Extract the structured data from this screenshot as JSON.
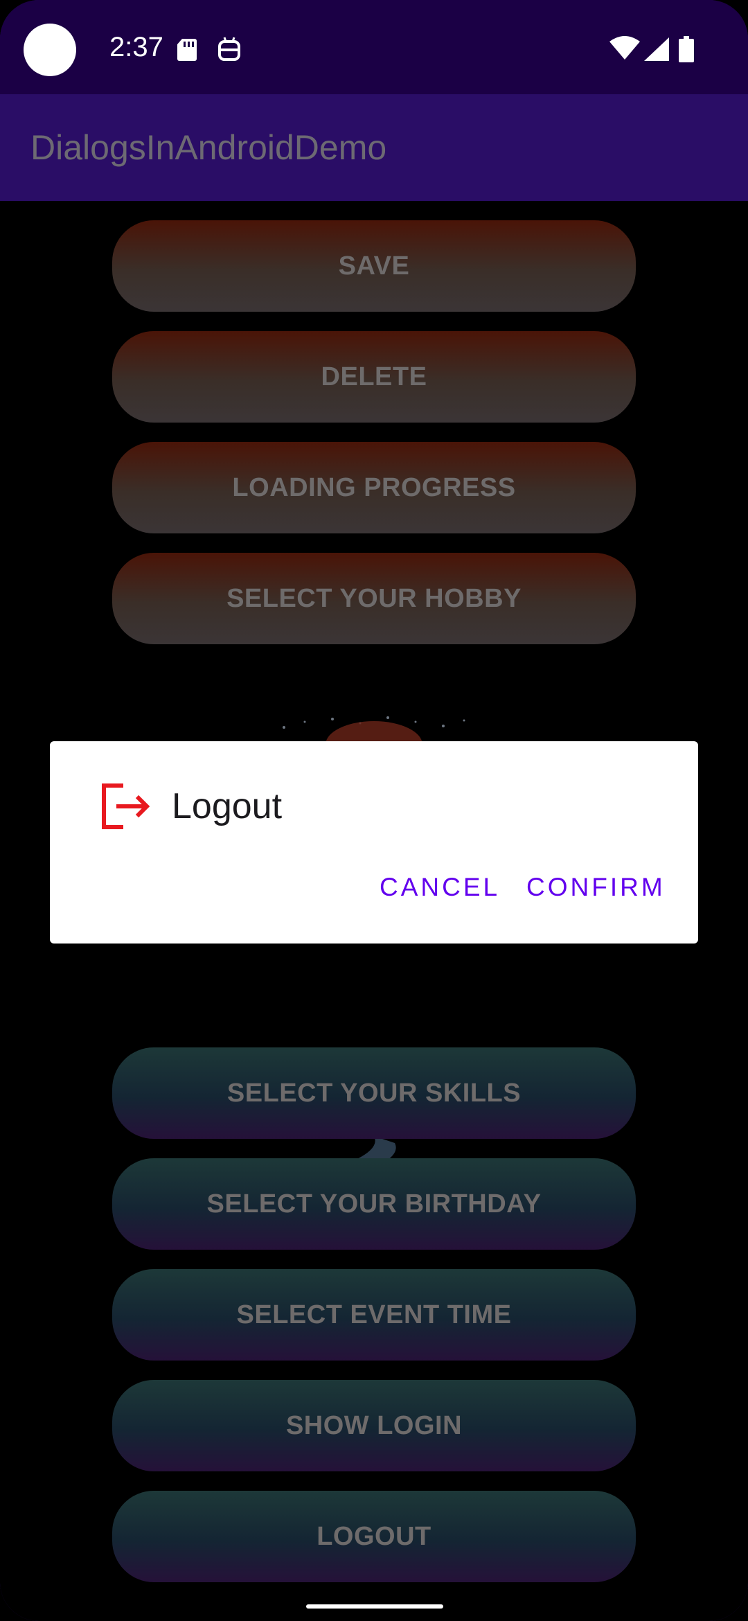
{
  "status_bar": {
    "time": "2:37",
    "icons": [
      "camera-dot",
      "sd-card-icon",
      "robot-icon",
      "wifi-icon",
      "signal-icon",
      "battery-icon"
    ]
  },
  "app_bar": {
    "title": "DialogsInAndroidDemo"
  },
  "buttons": {
    "save": "SAVE",
    "delete": "DELETE",
    "loading_progress": "LOADING PROGRESS",
    "select_hobby": "SELECT YOUR HOBBY",
    "select_skills": "SELECT YOUR SKILLS",
    "select_birthday": "SELECT YOUR BIRTHDAY",
    "select_event_time": "SELECT EVENT TIME",
    "show_login": "SHOW LOGIN",
    "logout": "LOGOUT"
  },
  "dialog": {
    "icon": "logout-icon",
    "title": "Logout",
    "cancel": "CANCEL",
    "confirm": "CONFIRM"
  },
  "colors": {
    "app_bar": "#2a0d66",
    "status_bar": "#1b0045",
    "dialog_action": "#6200ee",
    "dialog_icon": "#e8191f"
  }
}
